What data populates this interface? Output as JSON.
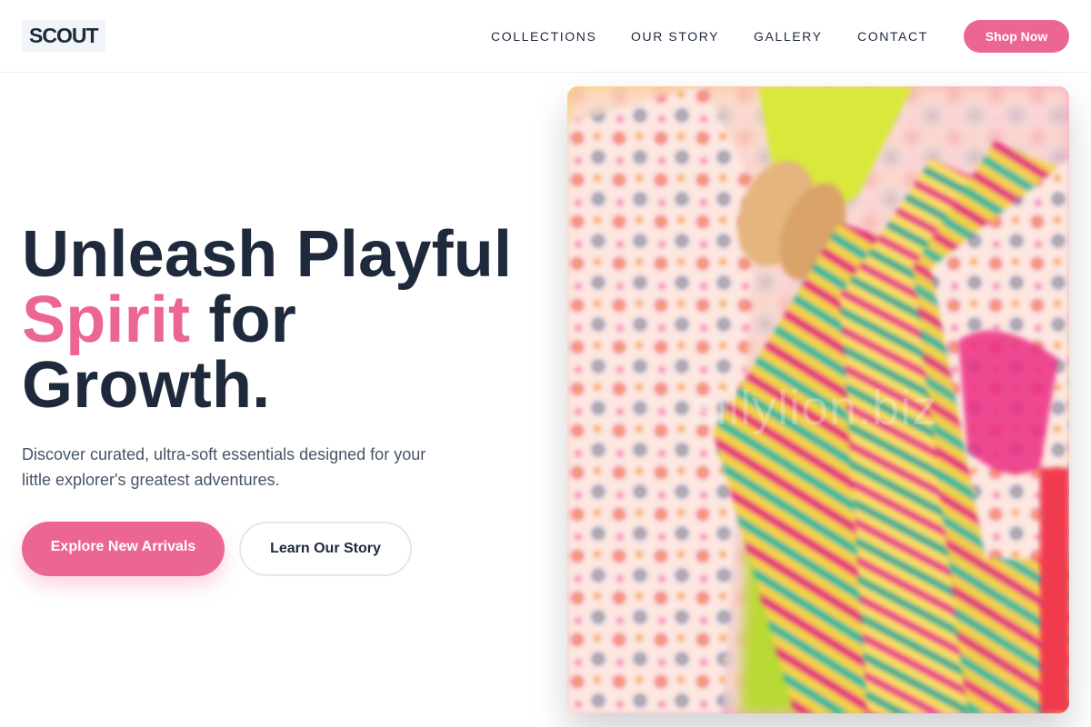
{
  "brand": {
    "logo_text": "SCOUT"
  },
  "nav": {
    "items": [
      {
        "label": "COLLECTIONS"
      },
      {
        "label": "OUR STORY"
      },
      {
        "label": "GALLERY"
      },
      {
        "label": "CONTACT"
      }
    ],
    "cta_label": "Shop Now"
  },
  "hero": {
    "headline_line1": "Unleash Playful",
    "headline_accent": "Spirit",
    "headline_after_accent": " for",
    "headline_line3": "Growth.",
    "subtext": "Discover curated, ultra-soft essentials designed for your little explorer's greatest adventures.",
    "primary_button": "Explore New Arrivals",
    "secondary_button": "Learn Our Story",
    "image_description_icon": "clothing-rack-photo",
    "watermark": "sillylion.biz"
  },
  "colors": {
    "accent": "#ec6695",
    "text_dark": "#1e293b",
    "text_muted": "#475569"
  }
}
